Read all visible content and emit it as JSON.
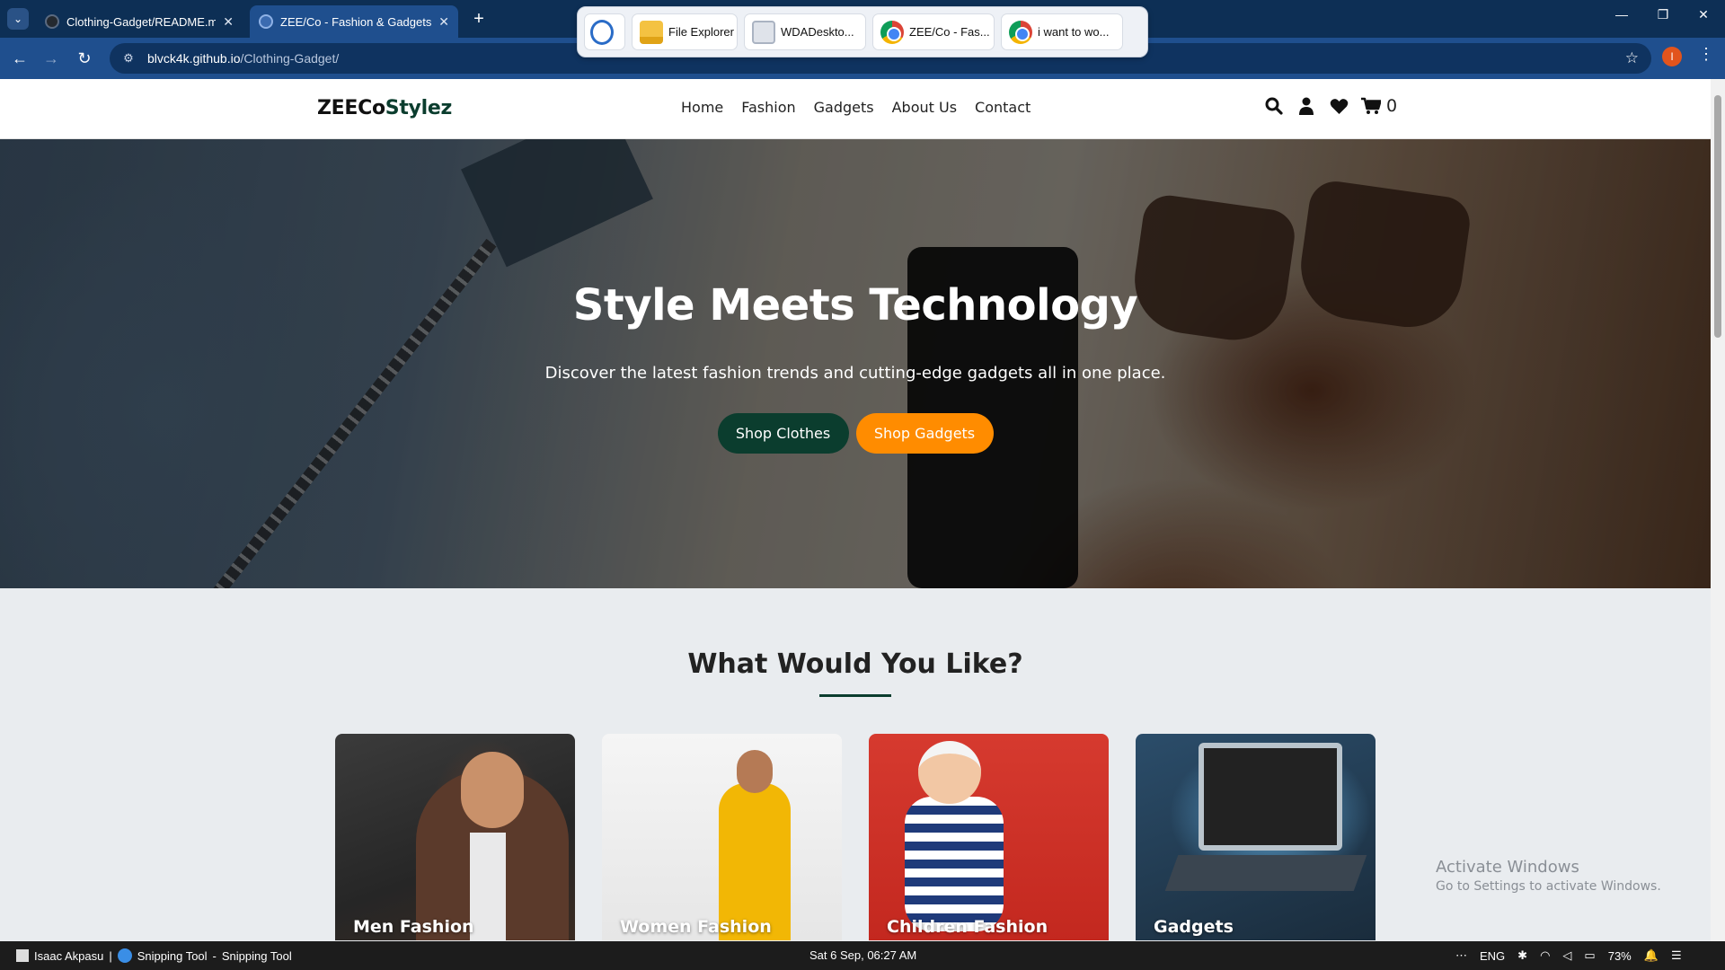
{
  "browser": {
    "tabs": [
      {
        "title": "Clothing-Gadget/README.md a",
        "active": false
      },
      {
        "title": "ZEE/Co - Fashion & Gadgets St",
        "active": true
      }
    ],
    "url_host": "blvck4k.github.io",
    "url_path": "/Clothing-Gadget/",
    "profile_initial": "I",
    "snap_items": [
      "",
      "File Explorer",
      "WDADeskto...",
      "ZEE/Co - Fas...",
      "i want to wo..."
    ]
  },
  "site": {
    "logo_main": "ZEECo",
    "logo_accent": "Stylez",
    "nav": [
      "Home",
      "Fashion",
      "Gadgets",
      "About Us",
      "Contact"
    ],
    "cart_count": "0"
  },
  "hero": {
    "title": "Style Meets Technology",
    "subtitle": "Discover the latest fashion trends and cutting-edge gadgets all in one place.",
    "btn_clothes": "Shop Clothes",
    "btn_gadgets": "Shop Gadgets"
  },
  "categories": {
    "title": "What Would You Like?",
    "items": [
      "Men Fashion",
      "Women Fashion",
      "Children Fashion",
      "Gadgets"
    ]
  },
  "watermark": {
    "line1": "Activate Windows",
    "line2": "Go to Settings to activate Windows."
  },
  "taskbar": {
    "user": "Isaac Akpasu",
    "app": "Snipping Tool",
    "app_title": "Snipping Tool",
    "clock": "Sat 6 Sep, 06:27 AM",
    "lang": "ENG",
    "battery": "73%"
  },
  "colors": {
    "brand_green": "#0b3d2e",
    "brand_orange": "#ff8c00",
    "chrome_blue": "#1f4f8e"
  }
}
